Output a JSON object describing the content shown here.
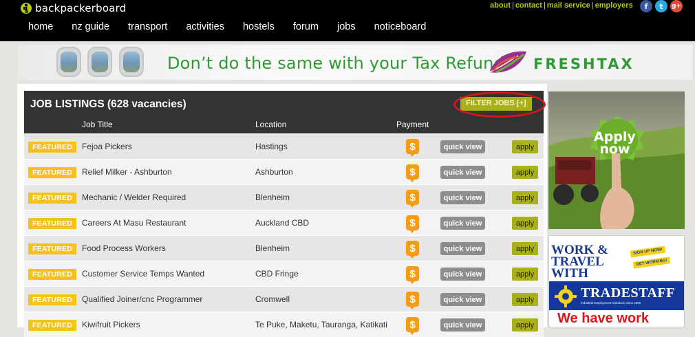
{
  "header": {
    "logo_text": "backpackerboard",
    "top_links": [
      "about",
      "contact",
      "mail service",
      "employers"
    ],
    "social": [
      {
        "icon": "facebook-icon",
        "glyph": "f",
        "color": "#3b5998"
      },
      {
        "icon": "twitter-icon",
        "glyph": "t",
        "color": "#2aa9e0"
      },
      {
        "icon": "google-plus-icon",
        "glyph": "g+",
        "color": "#dd4b39"
      }
    ],
    "nav": [
      "home",
      "nz guide",
      "transport",
      "activities",
      "hostels",
      "forum",
      "jobs",
      "noticeboard"
    ]
  },
  "banner": {
    "text": "Don’t do the same with your Tax Refund.",
    "brand": "FRESHTAX"
  },
  "listings": {
    "title": "JOB LISTINGS",
    "count": "(628 vacancies)",
    "filter_label": "FILTER JOBS [+]",
    "columns": {
      "title": "Job Title",
      "location": "Location",
      "payment": "Payment"
    },
    "featured_label": "FEATURED",
    "quick_view_label": "quick view",
    "apply_label": "apply",
    "pay_glyph": "$",
    "rows": [
      {
        "title": "Fejoa Pickers",
        "location": "Hastings"
      },
      {
        "title": "Relief Milker - Ashburton",
        "location": "Ashburton"
      },
      {
        "title": "Mechanic / Welder Required",
        "location": "Blenheim"
      },
      {
        "title": "Careers At Masu Restaurant",
        "location": "Auckland CBD"
      },
      {
        "title": "Food Process Workers",
        "location": "Blenheim"
      },
      {
        "title": "Customer Service Temps Wanted",
        "location": "CBD Fringe"
      },
      {
        "title": "Qualified Joiner/cnc Programmer",
        "location": "Cromwell"
      },
      {
        "title": "Kiwifruit Pickers",
        "location": "Te Puke, Maketu, Tauranga, Katikati"
      }
    ]
  },
  "ads": {
    "apply_now_line1": "Apply",
    "apply_now_line2": "now",
    "work_travel": "WORK & TRAVEL WITH",
    "sign_up": "SIGN UP NOW!",
    "get_working": "GET WORKING!",
    "tradestaff": "TRADESTAFF",
    "tradestaff_sub": "Industrial Employment Solutions since 1996",
    "we_have_work": "We have work"
  },
  "colors": {
    "brand_green": "#a8b11a",
    "featured_yellow": "#f5c21a",
    "pay_orange": "#f29c1a",
    "highlight_red": "#d8151c",
    "header_dark": "#333333"
  }
}
